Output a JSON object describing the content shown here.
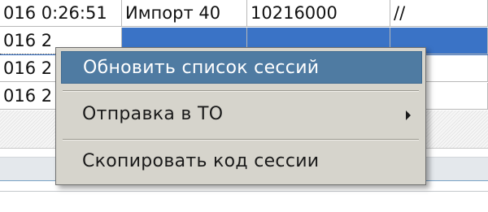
{
  "grid": {
    "rows": [
      {
        "date": "016 0:26:51",
        "name": "Импорт 40",
        "code": "10216000",
        "path": "//"
      },
      {
        "date": "016 2",
        "name": "",
        "code": "",
        "path": ""
      },
      {
        "date": "016 2",
        "name": "",
        "code": "",
        "path": ""
      },
      {
        "date": "016 2",
        "name": "",
        "code": "",
        "path": ""
      }
    ]
  },
  "context_menu": {
    "items": [
      {
        "label": "Обновить список сессий",
        "highlighted": true
      },
      {
        "label": "Отправка в ТО",
        "has_submenu": true
      },
      {
        "label": "Скопировать код сессии"
      }
    ],
    "highlight_color": "#4f7ba2",
    "selection_color": "#3a73c6"
  }
}
